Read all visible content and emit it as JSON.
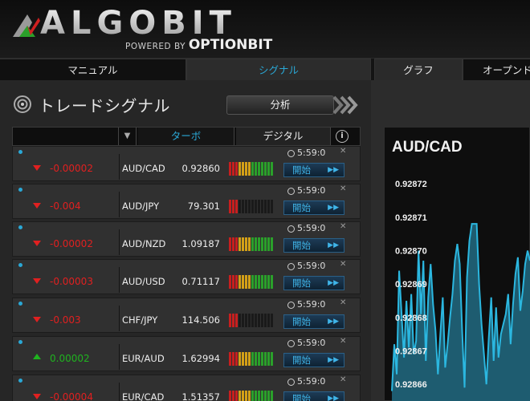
{
  "brand": {
    "logo_text": "ALGOBIT",
    "powered_by": "POWERED BY",
    "partner": "OPTIONBIT"
  },
  "tabs": [
    {
      "label": "マニュアル",
      "active": false
    },
    {
      "label": "シグナル",
      "active": true
    },
    {
      "label": "グラフ",
      "active": false
    },
    {
      "label": "オープンド",
      "active": false
    }
  ],
  "signals": {
    "title": "トレードシグナル",
    "analysis_button": "分析",
    "tab_turbo": "ターボ",
    "tab_digital": "デジタル",
    "info_label": "i",
    "open_label": "開始",
    "rows": [
      {
        "direction": "down",
        "change": "-0.00002",
        "pair": "AUD/CAD",
        "price": "0.92860",
        "timer": "5:59:0",
        "strength": 10
      },
      {
        "direction": "down",
        "change": "-0.004",
        "pair": "AUD/JPY",
        "price": "79.301",
        "timer": "5:59:0",
        "strength": 3
      },
      {
        "direction": "down",
        "change": "-0.00002",
        "pair": "AUD/NZD",
        "price": "1.09187",
        "timer": "5:59:0",
        "strength": 10
      },
      {
        "direction": "down",
        "change": "-0.00003",
        "pair": "AUD/USD",
        "price": "0.71117",
        "timer": "5:59:0",
        "strength": 10
      },
      {
        "direction": "down",
        "change": "-0.003",
        "pair": "CHF/JPY",
        "price": "114.506",
        "timer": "5:59:0",
        "strength": 3
      },
      {
        "direction": "up",
        "change": "0.00002",
        "pair": "EUR/AUD",
        "price": "1.62994",
        "timer": "5:59:0",
        "strength": 10
      },
      {
        "direction": "down",
        "change": "-0.00004",
        "pair": "EUR/CAD",
        "price": "1.51357",
        "timer": "5:59:0",
        "strength": 10
      }
    ]
  },
  "chart_data": {
    "type": "area",
    "title": "AUD/CAD",
    "yticks": [
      "0.92872",
      "0.92871",
      "0.92870",
      "0.92869",
      "0.92868",
      "0.92867",
      "0.92866"
    ],
    "ylim": [
      0.928655,
      0.928727
    ],
    "x": [
      0,
      1,
      2,
      3,
      4,
      5,
      6,
      7,
      8,
      9,
      10,
      11,
      12,
      13,
      14,
      15,
      16,
      17,
      18,
      19,
      20,
      21,
      22,
      23,
      24,
      25,
      26,
      27,
      28,
      29,
      30,
      31,
      32,
      33,
      34,
      35,
      36,
      37,
      38,
      39,
      40,
      41,
      42,
      43,
      44,
      45,
      46,
      47,
      48,
      49,
      50,
      51,
      52,
      53,
      54,
      55,
      56,
      57
    ],
    "values": [
      0.928658,
      0.928672,
      0.928663,
      0.928694,
      0.928681,
      0.928668,
      0.928685,
      0.928671,
      0.928687,
      0.928669,
      0.928673,
      0.9287,
      0.928681,
      0.928697,
      0.928667,
      0.928686,
      0.928696,
      0.928684,
      0.928676,
      0.928663,
      0.928675,
      0.928686,
      0.928665,
      0.928672,
      0.92868,
      0.928687,
      0.928697,
      0.928702,
      0.928696,
      0.928676,
      0.928659,
      0.928692,
      0.928703,
      0.928708,
      0.928708,
      0.928708,
      0.92869,
      0.928678,
      0.928669,
      0.92866,
      0.928674,
      0.928686,
      0.928667,
      0.928683,
      0.928668,
      0.928675,
      0.928678,
      0.928681,
      0.928687,
      0.928672,
      0.928684,
      0.928693,
      0.928698,
      0.928682,
      0.928688,
      0.928696,
      0.9287,
      0.928697
    ],
    "grid": false,
    "colors": {
      "fill": "#1e5c70",
      "line": "#2bb7e0"
    }
  },
  "colors": {
    "accent": "#2aa8d6",
    "negative": "#e02020",
    "positive": "#1fb31f"
  }
}
